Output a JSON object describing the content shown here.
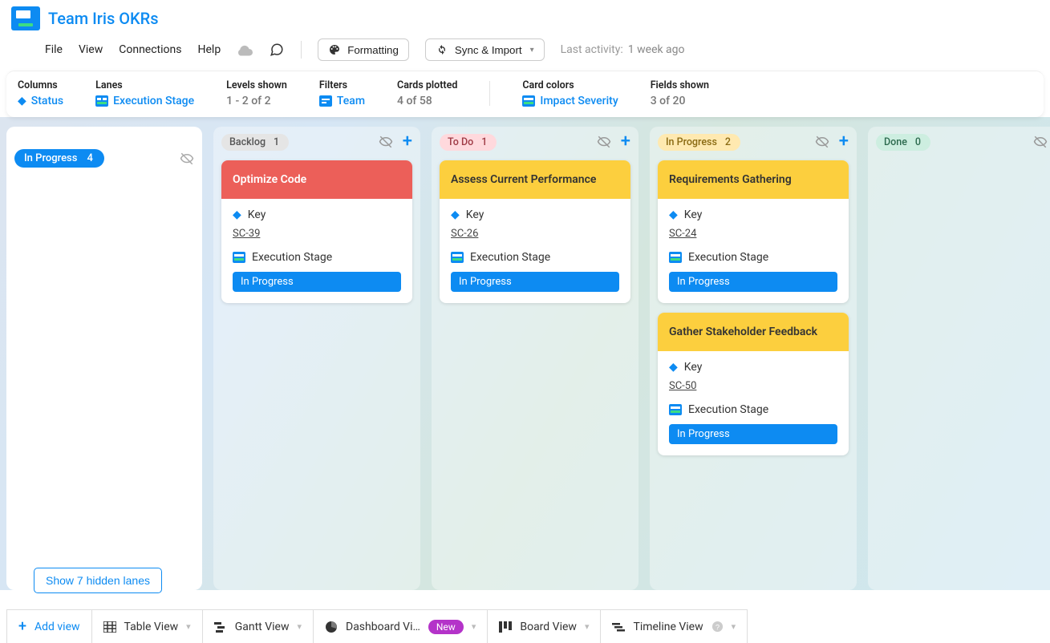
{
  "app": {
    "title": "Team Iris OKRs"
  },
  "menu": {
    "file": "File",
    "view": "View",
    "connections": "Connections",
    "help": "Help",
    "formatting": "Formatting",
    "sync": "Sync & Import",
    "activity_label": "Last activity:",
    "activity_value": "1 week ago"
  },
  "filters": {
    "columns_label": "Columns",
    "columns_value": "Status",
    "lanes_label": "Lanes",
    "lanes_value": "Execution Stage",
    "levels_label": "Levels shown",
    "levels_value": "1 - 2 of 2",
    "filters_label": "Filters",
    "filters_value": "Team",
    "cards_label": "Cards plotted",
    "cards_value": "4 of 58",
    "colors_label": "Card colors",
    "colors_value": "Impact Severity",
    "fields_label": "Fields shown",
    "fields_value": "3 of 20"
  },
  "lane": {
    "name": "In Progress",
    "count": "4"
  },
  "columns": [
    {
      "name": "Backlog",
      "count": "1",
      "pill": "pill-backlog"
    },
    {
      "name": "To Do",
      "count": "1",
      "pill": "pill-todo"
    },
    {
      "name": "In Progress",
      "count": "2",
      "pill": "pill-inprogress-h"
    },
    {
      "name": "Done",
      "count": "0",
      "pill": "pill-done"
    }
  ],
  "cards": {
    "backlog": [
      {
        "title": "Optimize Code",
        "color": "red",
        "key_label": "Key",
        "key": "SC-39",
        "stage_label": "Execution Stage",
        "stage": "In Progress"
      }
    ],
    "todo": [
      {
        "title": "Assess Current Performance",
        "color": "yellow",
        "key_label": "Key",
        "key": "SC-26",
        "stage_label": "Execution Stage",
        "stage": "In Progress"
      }
    ],
    "inprogress": [
      {
        "title": "Requirements Gathering",
        "color": "yellow",
        "key_label": "Key",
        "key": "SC-24",
        "stage_label": "Execution Stage",
        "stage": "In Progress"
      },
      {
        "title": "Gather Stakeholder Feedback",
        "color": "yellow",
        "key_label": "Key",
        "key": "SC-50",
        "stage_label": "Execution Stage",
        "stage": "In Progress"
      }
    ],
    "done": []
  },
  "hidden_lanes": "Show 7 hidden lanes",
  "views": {
    "add": "Add view",
    "table": "Table View",
    "gantt": "Gantt View",
    "dashboard": "Dashboard Vi…",
    "dashboard_badge": "New",
    "board": "Board View",
    "timeline": "Timeline View"
  },
  "icons": {
    "diamond": "◆",
    "chevron_down": "▾"
  }
}
